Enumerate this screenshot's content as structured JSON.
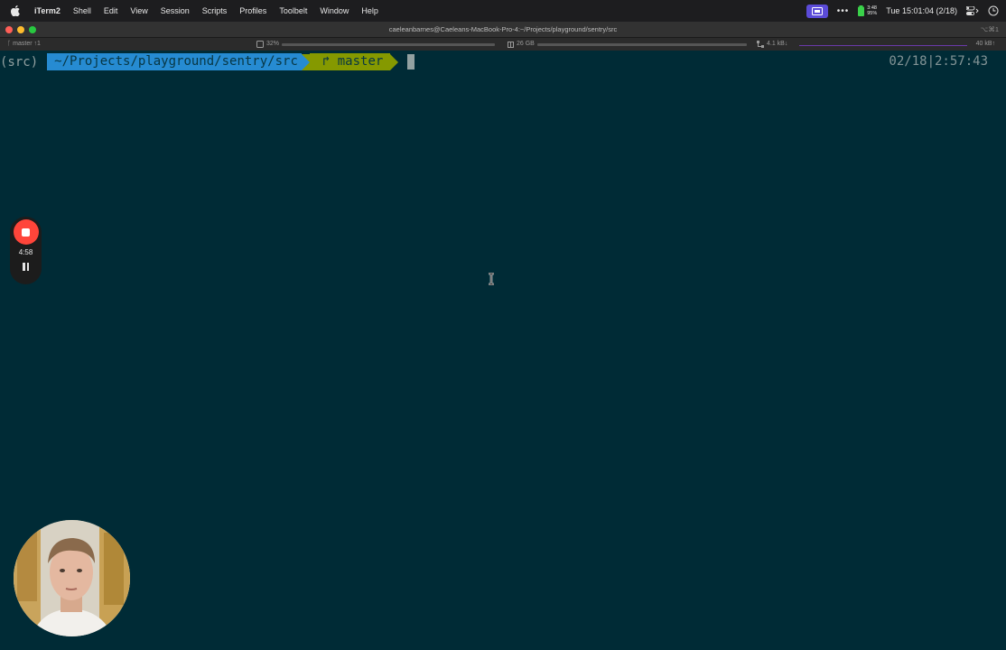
{
  "menubar": {
    "app_name": "iTerm2",
    "items": [
      "Shell",
      "Edit",
      "View",
      "Session",
      "Scripts",
      "Profiles",
      "Toolbelt",
      "Window",
      "Help"
    ],
    "battery_time": "3:48",
    "battery_percent": "95%",
    "clock": "Tue 15:01:04 (2/18)"
  },
  "window": {
    "title": "caeleanbarnes@Caeleans-MacBook-Pro-4:~/Projects/playground/sentry/src",
    "shortcut": "⌥⌘1"
  },
  "statusbar": {
    "git_branch": "ᚴ master ↑1",
    "cpu": "32%",
    "memory": "26 GB",
    "net_down": "4.1 kB↓",
    "net_up": "40 kB↑"
  },
  "terminal": {
    "venv": "(src)",
    "path": "~/Projects/playground/sentry/src",
    "git": "↱ master",
    "right_prompt": "02/18|2:57:43"
  },
  "recorder": {
    "elapsed": "4:58"
  },
  "colors": {
    "terminal_bg": "#002b36",
    "path_segment": "#268bd2",
    "git_segment": "#859900",
    "record_red": "#ff453a"
  }
}
